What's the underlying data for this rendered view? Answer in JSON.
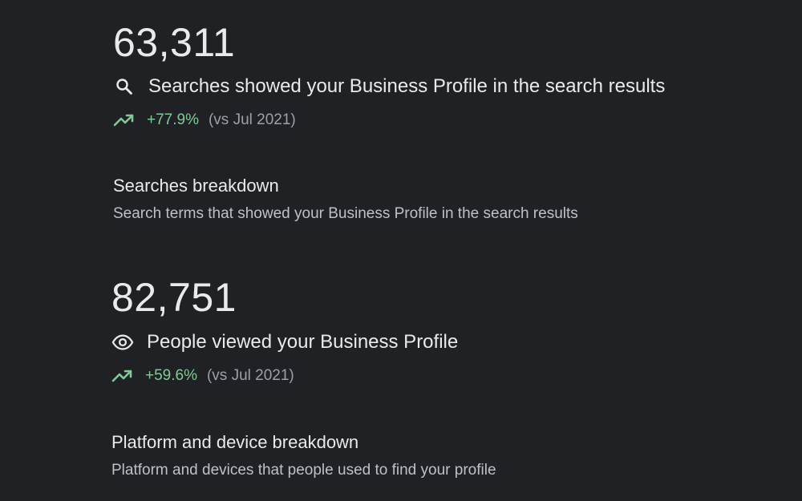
{
  "colors": {
    "background": "#202124",
    "text_primary": "#e8eaed",
    "text_secondary": "#bdc1c6",
    "trend_positive": "#81c995",
    "muted": "#9aa0a6"
  },
  "searches": {
    "value": "63,311",
    "label": "Searches showed your Business Profile in the search results",
    "icon": "search-icon",
    "trend_pct": "+77.9%",
    "trend_compare": "(vs Jul 2021)",
    "trend_icon": "trending-up-icon"
  },
  "searches_breakdown": {
    "title": "Searches breakdown",
    "subtitle": "Search terms that showed your Business Profile in the search results"
  },
  "views": {
    "value": "82,751",
    "label": "People viewed your Business Profile",
    "icon": "eye-icon",
    "trend_pct": "+59.6%",
    "trend_compare": "(vs Jul 2021)",
    "trend_icon": "trending-up-icon"
  },
  "platform_breakdown": {
    "title": "Platform and device breakdown",
    "subtitle": "Platform and devices that people used to find your profile"
  }
}
